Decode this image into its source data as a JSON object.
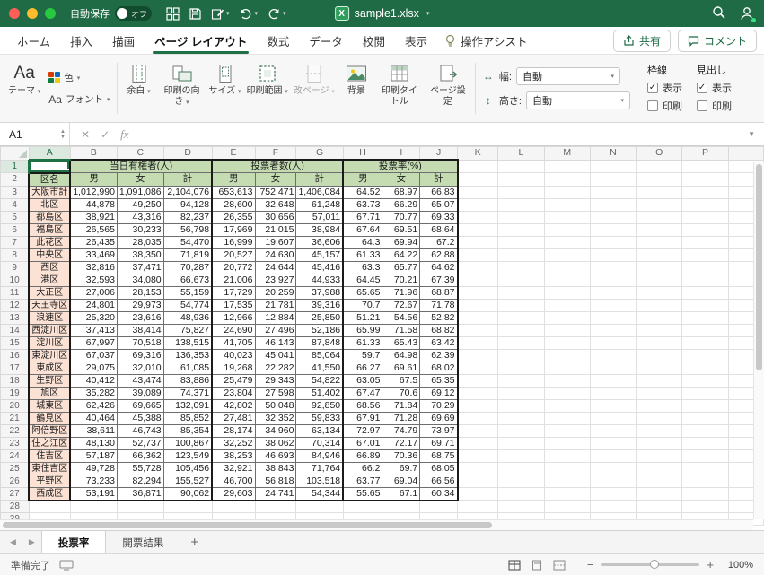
{
  "titlebar": {
    "autosave": "自動保存",
    "autosave_state": "オフ",
    "filename": "sample1.xlsx"
  },
  "tabs": {
    "items": [
      "ホーム",
      "挿入",
      "描画",
      "ページ レイアウト",
      "数式",
      "データ",
      "校閲",
      "表示"
    ],
    "active_index": 3,
    "assist": "操作アシスト",
    "share": "共有",
    "comment": "コメント"
  },
  "ribbon": {
    "theme": "テーマ",
    "colors": "色",
    "fonts": "フォント",
    "margins": "余白",
    "orientation": "印刷の向き",
    "size": "サイズ",
    "print_area": "印刷範囲",
    "page_breaks": "改ページ",
    "background": "背景",
    "print_titles": "印刷タイトル",
    "page_setup": "ページ設定",
    "width_label": "幅:",
    "height_label": "高さ:",
    "width_value": "自動",
    "height_value": "自動",
    "gridlines": "枠線",
    "headings": "見出し",
    "view_label": "表示",
    "print_label": "印刷",
    "gridlines_view_checked": true,
    "gridlines_print_checked": false,
    "headings_view_checked": true,
    "headings_print_checked": false
  },
  "formula": {
    "cell_ref": "A1",
    "fx": "fx"
  },
  "grid": {
    "col_letters": [
      "A",
      "B",
      "C",
      "D",
      "E",
      "F",
      "G",
      "H",
      "I",
      "J",
      "K",
      "L",
      "M",
      "N",
      "O",
      "P"
    ],
    "row_count": 29,
    "groups": [
      "当日有権者(人)",
      "投票者数(人)",
      "投票率(%)"
    ],
    "subheaders": [
      "区名",
      "男",
      "女",
      "計",
      "男",
      "女",
      "計",
      "男",
      "女",
      "計"
    ],
    "rows": [
      [
        "大阪市計",
        "1,012,990",
        "1,091,086",
        "2,104,076",
        "653,613",
        "752,471",
        "1,406,084",
        "64.52",
        "68.97",
        "66.83"
      ],
      [
        "北区",
        "44,878",
        "49,250",
        "94,128",
        "28,600",
        "32,648",
        "61,248",
        "63.73",
        "66.29",
        "65.07"
      ],
      [
        "都島区",
        "38,921",
        "43,316",
        "82,237",
        "26,355",
        "30,656",
        "57,011",
        "67.71",
        "70.77",
        "69.33"
      ],
      [
        "福島区",
        "26,565",
        "30,233",
        "56,798",
        "17,969",
        "21,015",
        "38,984",
        "67.64",
        "69.51",
        "68.64"
      ],
      [
        "此花区",
        "26,435",
        "28,035",
        "54,470",
        "16,999",
        "19,607",
        "36,606",
        "64.3",
        "69.94",
        "67.2"
      ],
      [
        "中央区",
        "33,469",
        "38,350",
        "71,819",
        "20,527",
        "24,630",
        "45,157",
        "61.33",
        "64.22",
        "62.88"
      ],
      [
        "西区",
        "32,816",
        "37,471",
        "70,287",
        "20,772",
        "24,644",
        "45,416",
        "63.3",
        "65.77",
        "64.62"
      ],
      [
        "港区",
        "32,593",
        "34,080",
        "66,673",
        "21,006",
        "23,927",
        "44,933",
        "64.45",
        "70.21",
        "67.39"
      ],
      [
        "大正区",
        "27,006",
        "28,153",
        "55,159",
        "17,729",
        "20,259",
        "37,988",
        "65.65",
        "71.96",
        "68.87"
      ],
      [
        "天王寺区",
        "24,801",
        "29,973",
        "54,774",
        "17,535",
        "21,781",
        "39,316",
        "70.7",
        "72.67",
        "71.78"
      ],
      [
        "浪速区",
        "25,320",
        "23,616",
        "48,936",
        "12,966",
        "12,884",
        "25,850",
        "51.21",
        "54.56",
        "52.82"
      ],
      [
        "西淀川区",
        "37,413",
        "38,414",
        "75,827",
        "24,690",
        "27,496",
        "52,186",
        "65.99",
        "71.58",
        "68.82"
      ],
      [
        "淀川区",
        "67,997",
        "70,518",
        "138,515",
        "41,705",
        "46,143",
        "87,848",
        "61.33",
        "65.43",
        "63.42"
      ],
      [
        "東淀川区",
        "67,037",
        "69,316",
        "136,353",
        "40,023",
        "45,041",
        "85,064",
        "59.7",
        "64.98",
        "62.39"
      ],
      [
        "東成区",
        "29,075",
        "32,010",
        "61,085",
        "19,268",
        "22,282",
        "41,550",
        "66.27",
        "69.61",
        "68.02"
      ],
      [
        "生野区",
        "40,412",
        "43,474",
        "83,886",
        "25,479",
        "29,343",
        "54,822",
        "63.05",
        "67.5",
        "65.35"
      ],
      [
        "旭区",
        "35,282",
        "39,089",
        "74,371",
        "23,804",
        "27,598",
        "51,402",
        "67.47",
        "70.6",
        "69.12"
      ],
      [
        "城東区",
        "62,426",
        "69,665",
        "132,091",
        "42,802",
        "50,048",
        "92,850",
        "68.56",
        "71.84",
        "70.29"
      ],
      [
        "鶴見区",
        "40,464",
        "45,388",
        "85,852",
        "27,481",
        "32,352",
        "59,833",
        "67.91",
        "71.28",
        "69.69"
      ],
      [
        "阿倍野区",
        "38,611",
        "46,743",
        "85,354",
        "28,174",
        "34,960",
        "63,134",
        "72.97",
        "74.79",
        "73.97"
      ],
      [
        "住之江区",
        "48,130",
        "52,737",
        "100,867",
        "32,252",
        "38,062",
        "70,314",
        "67.01",
        "72.17",
        "69.71"
      ],
      [
        "住吉区",
        "57,187",
        "66,362",
        "123,549",
        "38,253",
        "46,693",
        "84,946",
        "66.89",
        "70.36",
        "68.75"
      ],
      [
        "東住吉区",
        "49,728",
        "55,728",
        "105,456",
        "32,921",
        "38,843",
        "71,764",
        "66.2",
        "69.7",
        "68.05"
      ],
      [
        "平野区",
        "73,233",
        "82,294",
        "155,527",
        "46,700",
        "56,818",
        "103,518",
        "63.77",
        "69.04",
        "66.56"
      ],
      [
        "西成区",
        "53,191",
        "36,871",
        "90,062",
        "29,603",
        "24,741",
        "54,344",
        "55.65",
        "67.1",
        "60.34"
      ]
    ]
  },
  "sheets": {
    "tabs": [
      "投票率",
      "開票結果"
    ],
    "active_index": 0,
    "add": "+"
  },
  "status": {
    "ready": "準備完了",
    "zoom": "100%"
  }
}
